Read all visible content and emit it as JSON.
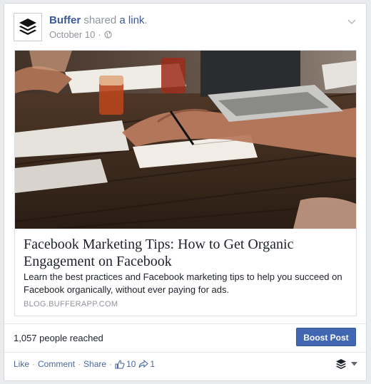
{
  "post": {
    "author": "Buffer",
    "action_prefix": "shared",
    "action_link": "a link",
    "action_suffix": ".",
    "date": "October 10",
    "separator": "·"
  },
  "link_preview": {
    "title": "Facebook Marketing Tips: How to Get Organic Engagement on Facebook",
    "description": "Learn the best practices and Facebook marketing tips to help you succeed on Facebook organically, without ever paying for ads.",
    "domain": "BLOG.BUFFERAPP.COM"
  },
  "insights": {
    "reach_text": "1,057 people reached",
    "boost_label": "Boost Post"
  },
  "actions": {
    "like": "Like",
    "comment": "Comment",
    "share": "Share",
    "sep": "·",
    "like_count": "10",
    "share_count": "1"
  },
  "icons": {
    "avatar": "buffer-logo-icon",
    "audience": "globe-icon",
    "menu": "chevron-down-icon",
    "like": "thumbs-up-icon",
    "share": "share-arrow-icon",
    "publisher": "buffer-stack-icon",
    "dropdown": "caret-down-icon"
  },
  "colors": {
    "link_blue": "#3b5998",
    "action_blue": "#4b67a1",
    "boost_bg": "#4267b2",
    "meta_gray": "#90949c"
  }
}
